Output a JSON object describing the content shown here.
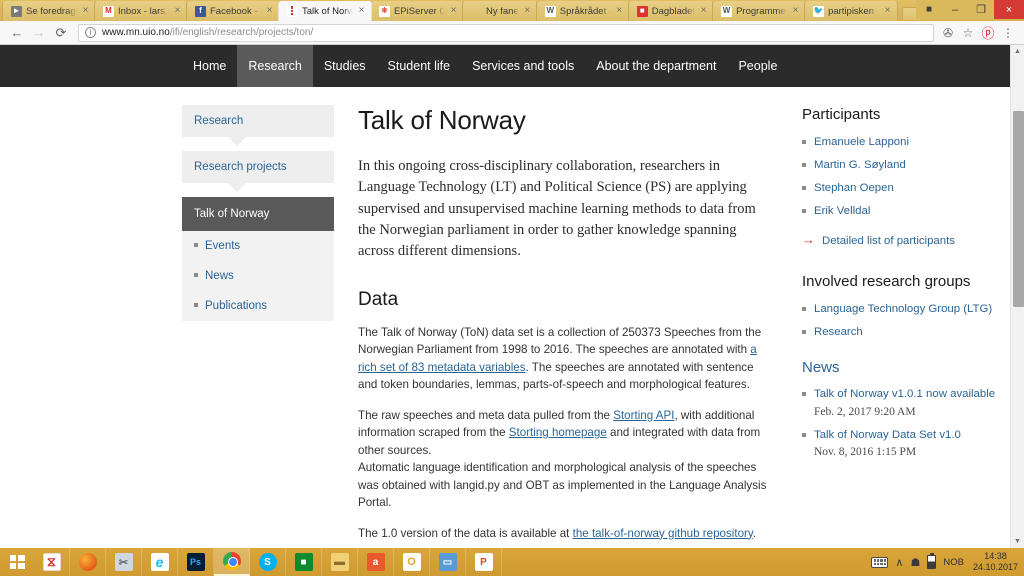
{
  "browser": {
    "tabs": [
      {
        "title": "Se foredrage",
        "favicon": "play-circle-icon",
        "active": false
      },
      {
        "title": "Inbox - lars.b",
        "favicon": "gmail-icon",
        "active": false
      },
      {
        "title": "Facebook - L",
        "favicon": "facebook-icon",
        "active": false
      },
      {
        "title": "Talk of Norwa",
        "favicon": "uio-icon",
        "active": true
      },
      {
        "title": "EPiServer CM",
        "favicon": "episerver-icon",
        "active": false
      },
      {
        "title": "Ny fane",
        "favicon": "blank-icon",
        "active": false
      },
      {
        "title": "Språkrådet –",
        "favicon": "wikipedia-icon",
        "active": false
      },
      {
        "title": "Dagbladet",
        "favicon": "dagbladet-icon",
        "active": false
      },
      {
        "title": "Programmer",
        "favicon": "wikipedia-icon",
        "active": false
      },
      {
        "title": "partipisken –",
        "favicon": "twitter-icon",
        "active": false
      }
    ],
    "tab_close_label": "×",
    "window_controls": {
      "user": "■",
      "minimize": "–",
      "maximize": "❐",
      "close": "×"
    },
    "toolbar": {
      "back": "←",
      "forward": "→",
      "reload": "⟳",
      "info_icon": "ⓘ",
      "url_domain": "www.mn.uio.no",
      "url_path": "/ifi/english/research/projects/ton/",
      "translate": "✇",
      "bookmark": "☆",
      "pinterest": "ⓟ",
      "menu": "⋮"
    }
  },
  "sitenav": {
    "items": [
      {
        "label": "Home",
        "active": false
      },
      {
        "label": "Research",
        "active": true
      },
      {
        "label": "Studies",
        "active": false
      },
      {
        "label": "Student life",
        "active": false
      },
      {
        "label": "Services and tools",
        "active": false
      },
      {
        "label": "About the department",
        "active": false
      },
      {
        "label": "People",
        "active": false
      }
    ]
  },
  "sidebar": {
    "crumbs": [
      {
        "label": "Research"
      },
      {
        "label": "Research projects"
      }
    ],
    "active": "Talk of Norway",
    "subnav": [
      {
        "label": "Events"
      },
      {
        "label": "News"
      },
      {
        "label": "Publications"
      }
    ]
  },
  "main": {
    "title": "Talk of Norway",
    "lead": "In this ongoing cross-disciplinary collaboration, researchers in Language Technology (LT) and Political Science (PS) are applying supervised and unsupervised machine learning methods to data from the Norwegian parliament in order to gather knowledge spanning across different dimensions.",
    "data_heading": "Data",
    "p1_a": "The Talk of Norway (ToN) data set is a collection of 250373 Speeches from the Norwegian Parliament from 1998 to 2016. The speeches are annotated with ",
    "p1_link": "a rich set of 83 metadata variables",
    "p1_b": ". The speeches are annotated with sentence and token boundaries, lemmas, parts-of-speech and morphological features.",
    "p2_a": "The raw speeches and meta data pulled from the ",
    "p2_link1": "Storting API",
    "p2_b": ", with additional information scraped from the ",
    "p2_link2": "Storting homepage",
    "p2_c": " and integrated with data from other sources.",
    "p2_d": "Automatic language identification and morphological analysis of the speeches was obtained with langid.py and OBT as implemented in the Language Analysis Portal.",
    "p3_a": "The 1.0 version of the data is available at ",
    "p3_link": "the talk-of-norway github repository",
    "p3_b": "."
  },
  "right": {
    "participants_title": "Participants",
    "participants": [
      {
        "name": "Emanuele Lapponi"
      },
      {
        "name": "Martin G. Søyland"
      },
      {
        "name": "Stephan Oepen"
      },
      {
        "name": "Erik Velldal"
      }
    ],
    "detailed_arrow": "→",
    "detailed_label": "Detailed list of participants",
    "groups_title": "Involved research groups",
    "groups": [
      {
        "name": "Language Technology Group (LTG)"
      },
      {
        "name": "Research"
      }
    ],
    "news_title": "News",
    "news": [
      {
        "headline": "Talk of Norway v1.0.1 now available",
        "date": "Feb. 2, 2017 9:20 AM"
      },
      {
        "headline": "Talk of Norway Data Set v1.0",
        "date": "Nov. 8, 2016 1:15 PM"
      }
    ]
  },
  "taskbar": {
    "start_label": "start-button",
    "apps": [
      {
        "name": "adobe-reader",
        "glyph": "✐",
        "cls": "ic-pdf",
        "open": false
      },
      {
        "name": "firefox",
        "glyph": "",
        "cls": "ic-ff",
        "open": false
      },
      {
        "name": "snipping-tool",
        "glyph": "✂",
        "cls": "ic-tool",
        "open": false
      },
      {
        "name": "internet-explorer",
        "glyph": "e",
        "cls": "ic-ie",
        "open": false
      },
      {
        "name": "photoshop",
        "glyph": "Ps",
        "cls": "ic-ps",
        "open": false
      },
      {
        "name": "google-chrome",
        "glyph": "",
        "cls": "ic-chrome",
        "open": true
      },
      {
        "name": "skype",
        "glyph": "S",
        "cls": "ic-skype",
        "open": false
      },
      {
        "name": "windows-store",
        "glyph": "■",
        "cls": "ic-store",
        "open": false
      },
      {
        "name": "file-explorer",
        "glyph": "▬",
        "cls": "ic-folder",
        "open": false
      },
      {
        "name": "acrobat",
        "glyph": "a",
        "cls": "ic-acr",
        "open": false
      },
      {
        "name": "outlook",
        "glyph": "O",
        "cls": "ic-out",
        "open": false
      },
      {
        "name": "sticky-notes",
        "glyph": "▭",
        "cls": "ic-note",
        "open": false
      },
      {
        "name": "powerpoint",
        "glyph": "P",
        "cls": "ic-pp",
        "open": false
      }
    ],
    "tray": {
      "show_desktop": "∧",
      "network": "❐",
      "language": "NOB",
      "time": "14:38",
      "date": "24.10.2017"
    }
  },
  "colors": {
    "chrome_frame": "#d9b95c",
    "site_nav_bg": "#2b2b2b",
    "active_crumb": "#595959",
    "link": "#2a6496",
    "arrow_red": "#d6301f",
    "taskbar": "#d9a63c"
  }
}
